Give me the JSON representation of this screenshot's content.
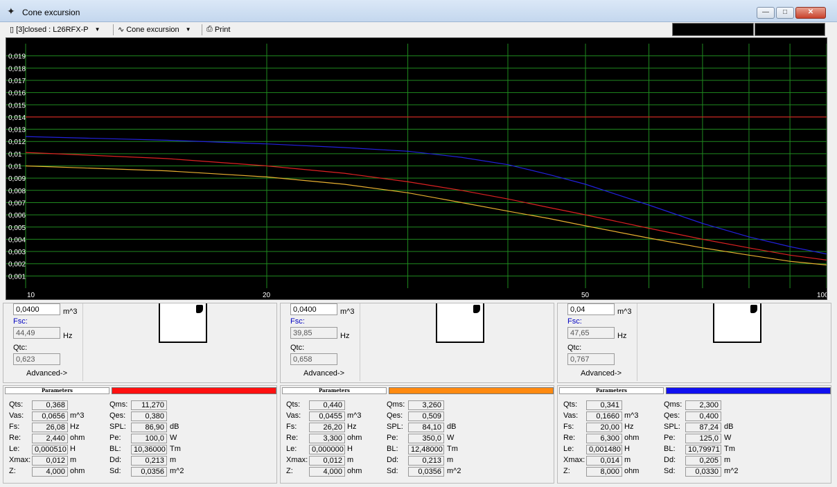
{
  "window": {
    "title": "Cone excursion",
    "minimize": "—",
    "maximize": "□",
    "close": "✕"
  },
  "toolbar": {
    "project": "[3]closed : L26RFX-P",
    "view": "Cone excursion",
    "print": "Print"
  },
  "chart_data": {
    "type": "line",
    "xscale": "log",
    "xlim": [
      10,
      100
    ],
    "ylim": [
      0,
      0.02
    ],
    "grid": true,
    "x_ticks": [
      "10",
      "20",
      "50",
      "100"
    ],
    "y_ticks": [
      "0,001",
      "0,002",
      "0,003",
      "0,004",
      "0,005",
      "0,006",
      "0,007",
      "0,008",
      "0,009",
      "0,01",
      "0,01",
      "0,012",
      "0,013",
      "0,014",
      "0,015",
      "0,016",
      "0,017",
      "0,018",
      "0,019"
    ],
    "series": [
      {
        "color": "#cc2222",
        "x": [
          10,
          100
        ],
        "y": [
          0.014,
          0.014
        ]
      },
      {
        "color": "#2222dd",
        "x": [
          10,
          15,
          20,
          25,
          30,
          35,
          40,
          45,
          50,
          60,
          70,
          80,
          90,
          100
        ],
        "y": [
          0.0124,
          0.0121,
          0.0118,
          0.0115,
          0.0112,
          0.0107,
          0.0101,
          0.0093,
          0.0085,
          0.0068,
          0.0053,
          0.0042,
          0.0034,
          0.0028
        ]
      },
      {
        "color": "#dd2222",
        "x": [
          10,
          15,
          20,
          25,
          30,
          35,
          40,
          45,
          50,
          60,
          70,
          80,
          90,
          100
        ],
        "y": [
          0.0111,
          0.0106,
          0.01,
          0.0094,
          0.0087,
          0.008,
          0.0073,
          0.0066,
          0.006,
          0.0049,
          0.004,
          0.0033,
          0.0027,
          0.0023
        ]
      },
      {
        "color": "#e8b030",
        "x": [
          10,
          15,
          20,
          25,
          30,
          35,
          40,
          45,
          50,
          60,
          70,
          80,
          90,
          100
        ],
        "y": [
          0.01,
          0.0096,
          0.0091,
          0.0085,
          0.0078,
          0.007,
          0.0063,
          0.0057,
          0.0051,
          0.0041,
          0.0033,
          0.0027,
          0.0022,
          0.0019
        ]
      }
    ]
  },
  "boxes": [
    {
      "vb": "0,0400",
      "vb_unit": "m^3",
      "fsc_label": "Fsc:",
      "fsc": "44,49",
      "fsc_unit": "Hz",
      "qtc_label": "Qtc:",
      "qtc": "0,623",
      "advanced": "Advanced->"
    },
    {
      "vb": "0,0400",
      "vb_unit": "m^3",
      "fsc_label": "Fsc:",
      "fsc": "39,85",
      "fsc_unit": "Hz",
      "qtc_label": "Qtc:",
      "qtc": "0,658",
      "advanced": "Advanced->"
    },
    {
      "vb": "0,04",
      "vb_unit": "m^3",
      "fsc_label": "Fsc:",
      "fsc": "47,65",
      "fsc_unit": "Hz",
      "qtc_label": "Qtc:",
      "qtc": "0,767",
      "advanced": "Advanced->"
    }
  ],
  "params": [
    {
      "tab": "Parameters",
      "color": "#ff1010",
      "left": [
        {
          "l": "Qts:",
          "v": "0,368",
          "u": ""
        },
        {
          "l": "Vas:",
          "v": "0,0656",
          "u": "m^3"
        },
        {
          "l": "Fs:",
          "v": "26,08",
          "u": "Hz"
        },
        {
          "l": "Re:",
          "v": "2,440",
          "u": "ohm"
        },
        {
          "l": "Le:",
          "v": "0,000510",
          "u": "H"
        },
        {
          "l": "Xmax:",
          "v": "0,012",
          "u": "m"
        },
        {
          "l": "Z:",
          "v": "4,000",
          "u": "ohm"
        }
      ],
      "right": [
        {
          "l": "Qms:",
          "v": "11,270",
          "u": ""
        },
        {
          "l": "Qes:",
          "v": "0,380",
          "u": ""
        },
        {
          "l": "SPL:",
          "v": "86,90",
          "u": "dB"
        },
        {
          "l": "Pe:",
          "v": "100,0",
          "u": "W"
        },
        {
          "l": "BL:",
          "v": "10,36000",
          "u": "Tm"
        },
        {
          "l": "Dd:",
          "v": "0,213",
          "u": "m"
        },
        {
          "l": "Sd:",
          "v": "0,0356",
          "u": "m^2"
        }
      ]
    },
    {
      "tab": "Parameters",
      "color": "#ff8a10",
      "left": [
        {
          "l": "Qts:",
          "v": "0,440",
          "u": ""
        },
        {
          "l": "Vas:",
          "v": "0,0455",
          "u": "m^3"
        },
        {
          "l": "Fs:",
          "v": "26,20",
          "u": "Hz"
        },
        {
          "l": "Re:",
          "v": "3,300",
          "u": "ohm"
        },
        {
          "l": "Le:",
          "v": "0,000000",
          "u": "H"
        },
        {
          "l": "Xmax:",
          "v": "0,012",
          "u": "m"
        },
        {
          "l": "Z:",
          "v": "4,000",
          "u": "ohm"
        }
      ],
      "right": [
        {
          "l": "Qms:",
          "v": "3,260",
          "u": ""
        },
        {
          "l": "Qes:",
          "v": "0,509",
          "u": ""
        },
        {
          "l": "SPL:",
          "v": "84,10",
          "u": "dB"
        },
        {
          "l": "Pe:",
          "v": "350,0",
          "u": "W"
        },
        {
          "l": "BL:",
          "v": "12,48000",
          "u": "Tm"
        },
        {
          "l": "Dd:",
          "v": "0,213",
          "u": "m"
        },
        {
          "l": "Sd:",
          "v": "0,0356",
          "u": "m^2"
        }
      ]
    },
    {
      "tab": "Parameters",
      "color": "#1010f0",
      "left": [
        {
          "l": "Qts:",
          "v": "0,341",
          "u": ""
        },
        {
          "l": "Vas:",
          "v": "0,1660",
          "u": "m^3"
        },
        {
          "l": "Fs:",
          "v": "20,00",
          "u": "Hz"
        },
        {
          "l": "Re:",
          "v": "6,300",
          "u": "ohm"
        },
        {
          "l": "Le:",
          "v": "0,001480",
          "u": "H"
        },
        {
          "l": "Xmax:",
          "v": "0,014",
          "u": "m"
        },
        {
          "l": "Z:",
          "v": "8,000",
          "u": "ohm"
        }
      ],
      "right": [
        {
          "l": "Qms:",
          "v": "2,300",
          "u": ""
        },
        {
          "l": "Qes:",
          "v": "0,400",
          "u": ""
        },
        {
          "l": "SPL:",
          "v": "87,24",
          "u": "dB"
        },
        {
          "l": "Pe:",
          "v": "125,0",
          "u": "W"
        },
        {
          "l": "BL:",
          "v": "10,79971",
          "u": "Tm"
        },
        {
          "l": "Dd:",
          "v": "0,205",
          "u": "m"
        },
        {
          "l": "Sd:",
          "v": "0,0330",
          "u": "m^2"
        }
      ]
    }
  ]
}
